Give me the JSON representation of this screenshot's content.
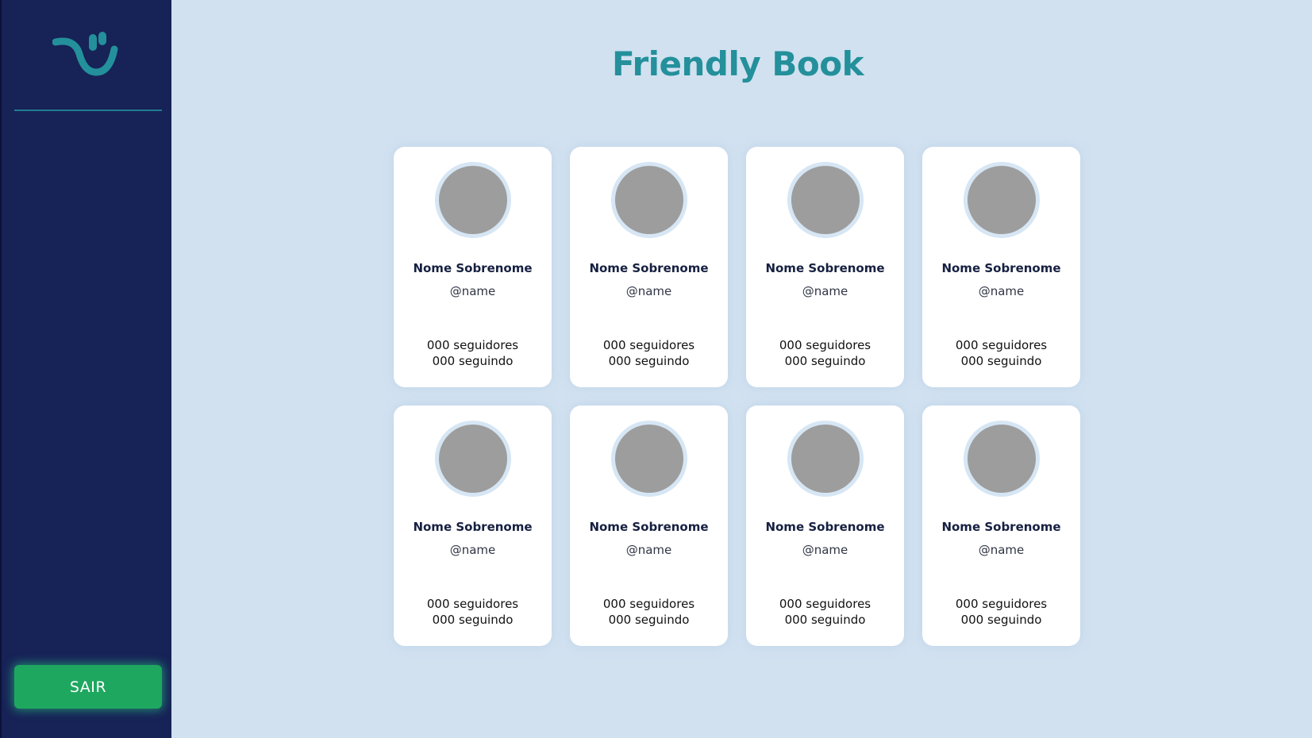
{
  "app": {
    "title": "Friendly Book",
    "colors": {
      "sidebar": "#172257",
      "background": "#d1e1f0",
      "accent": "#23909b",
      "logout": "#1ea75f"
    }
  },
  "sidebar": {
    "logo_icon": "smiley-logo-icon",
    "logout_label": "SAIR"
  },
  "users": [
    {
      "name": "Nome Sobrenome",
      "handle": "@name",
      "followers": "000 seguidores",
      "following": "000 seguindo"
    },
    {
      "name": "Nome Sobrenome",
      "handle": "@name",
      "followers": "000 seguidores",
      "following": "000 seguindo"
    },
    {
      "name": "Nome Sobrenome",
      "handle": "@name",
      "followers": "000 seguidores",
      "following": "000 seguindo"
    },
    {
      "name": "Nome Sobrenome",
      "handle": "@name",
      "followers": "000 seguidores",
      "following": "000 seguindo"
    },
    {
      "name": "Nome Sobrenome",
      "handle": "@name",
      "followers": "000 seguidores",
      "following": "000 seguindo"
    },
    {
      "name": "Nome Sobrenome",
      "handle": "@name",
      "followers": "000 seguidores",
      "following": "000 seguindo"
    },
    {
      "name": "Nome Sobrenome",
      "handle": "@name",
      "followers": "000 seguidores",
      "following": "000 seguindo"
    },
    {
      "name": "Nome Sobrenome",
      "handle": "@name",
      "followers": "000 seguidores",
      "following": "000 seguindo"
    }
  ]
}
